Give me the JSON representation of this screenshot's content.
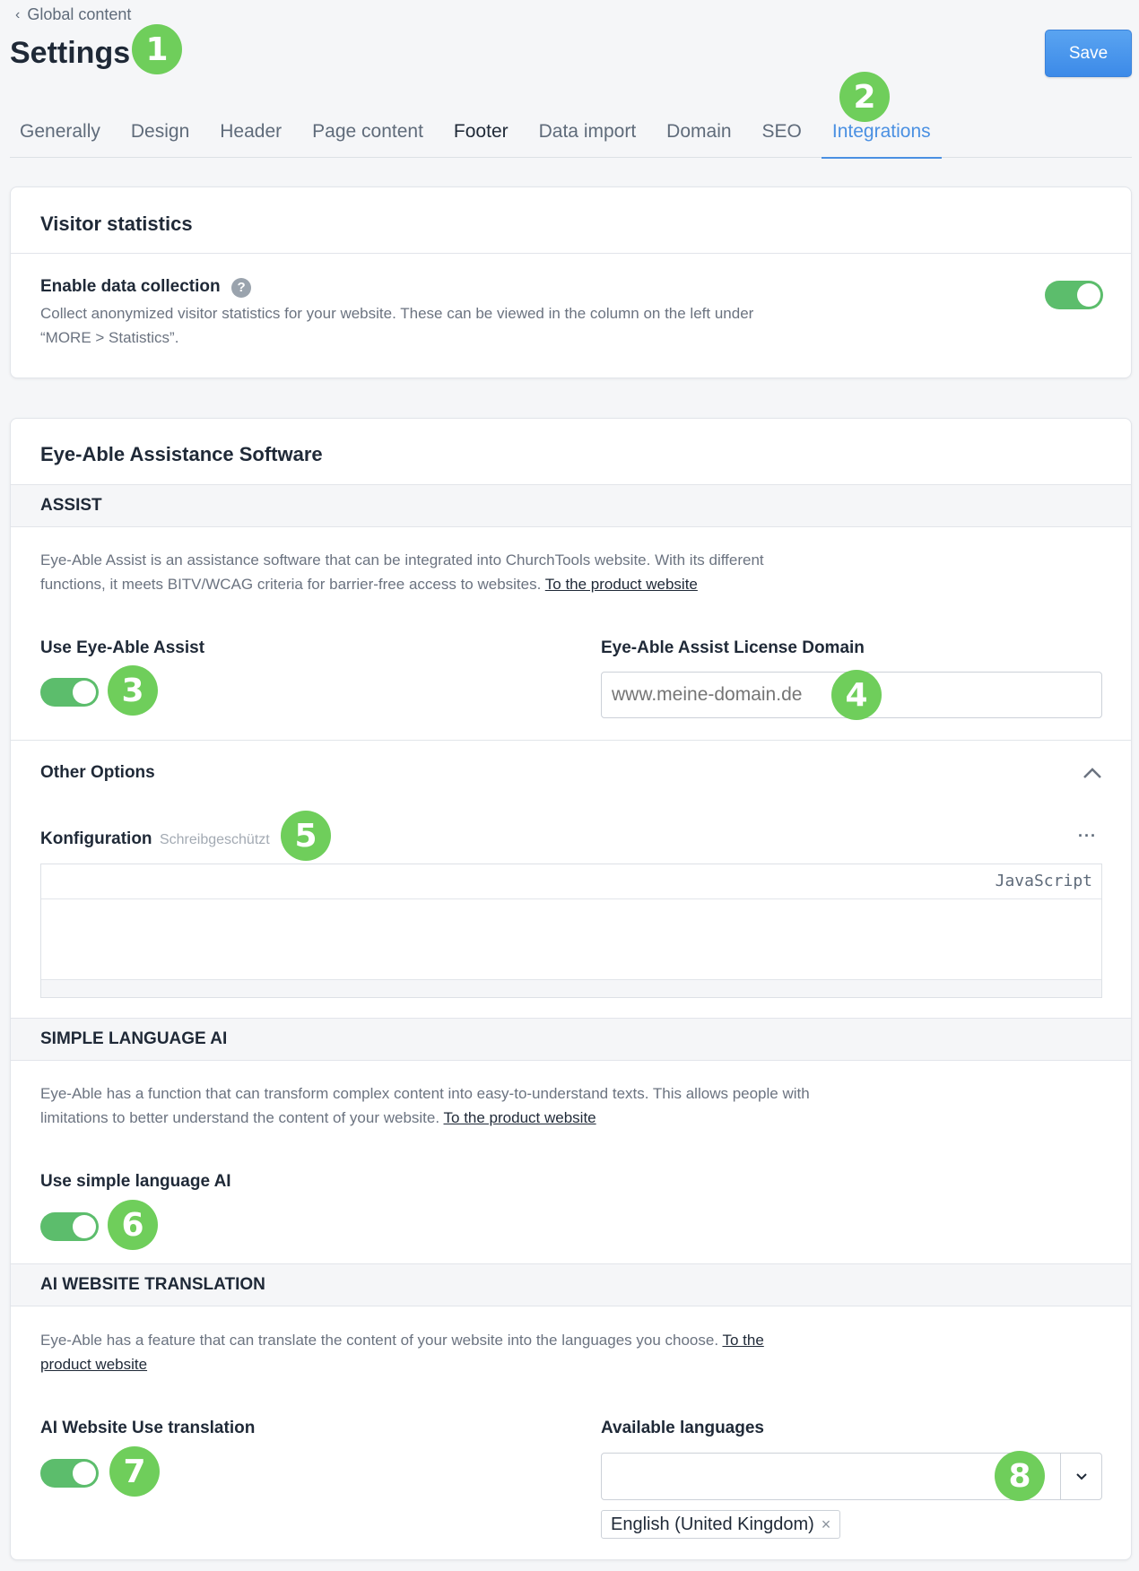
{
  "header": {
    "back_label": "Global content",
    "title": "Settings",
    "save_label": "Save"
  },
  "badges": [
    "1",
    "2",
    "3",
    "4",
    "5",
    "6",
    "7",
    "8"
  ],
  "tabs": [
    {
      "label": "Generally"
    },
    {
      "label": "Design"
    },
    {
      "label": "Header"
    },
    {
      "label": "Page content"
    },
    {
      "label": "Footer"
    },
    {
      "label": "Data import"
    },
    {
      "label": "Domain"
    },
    {
      "label": "SEO"
    },
    {
      "label": "Integrations"
    }
  ],
  "visitor_statistics": {
    "title": "Visitor statistics",
    "enable_label": "Enable data collection",
    "help_glyph": "?",
    "description": "Collect anonymized visitor statistics for your website. These can be viewed in the column on the left under “MORE > Statistics”.",
    "enabled": true
  },
  "eye_able": {
    "title": "Eye-Able Assistance Software",
    "assist": {
      "section_title": "ASSIST",
      "description": "Eye-Able Assist is an assistance software that can be integrated into ChurchTools website. With its different functions, it meets BITV/WCAG criteria for barrier-free access to websites.",
      "link_label": "To the product website",
      "use_label": "Use Eye-Able Assist",
      "use_enabled": true,
      "domain_label": "Eye-Able Assist License Domain",
      "domain_placeholder": "www.meine-domain.de",
      "domain_value": ""
    },
    "other_options": {
      "title": "Other Options",
      "config_label": "Konfiguration",
      "config_readonly": "Schreibgeschützt",
      "more_glyph": "···",
      "code_language": "JavaScript"
    },
    "simple_language": {
      "section_title": "SIMPLE LANGUAGE AI",
      "description": "Eye-Able has a function that can transform complex content into easy-to-understand texts. This allows people with limitations to better understand the content of your website.",
      "link_label": "To the product website",
      "use_label": "Use simple language AI",
      "use_enabled": true
    },
    "translation": {
      "section_title": "AI WEBSITE TRANSLATION",
      "description": "Eye-Able has a feature that can translate the content of your website into the languages you choose.",
      "link_label": "To the product website",
      "use_label": "AI Website Use translation",
      "use_enabled": true,
      "languages_label": "Available languages",
      "selected_languages": [
        "English (United Kingdom)"
      ],
      "remove_glyph": "×"
    }
  },
  "colors": {
    "accent": "#4a90e2",
    "toggle_on": "#5cbd6c",
    "badge": "#6fce5b"
  }
}
